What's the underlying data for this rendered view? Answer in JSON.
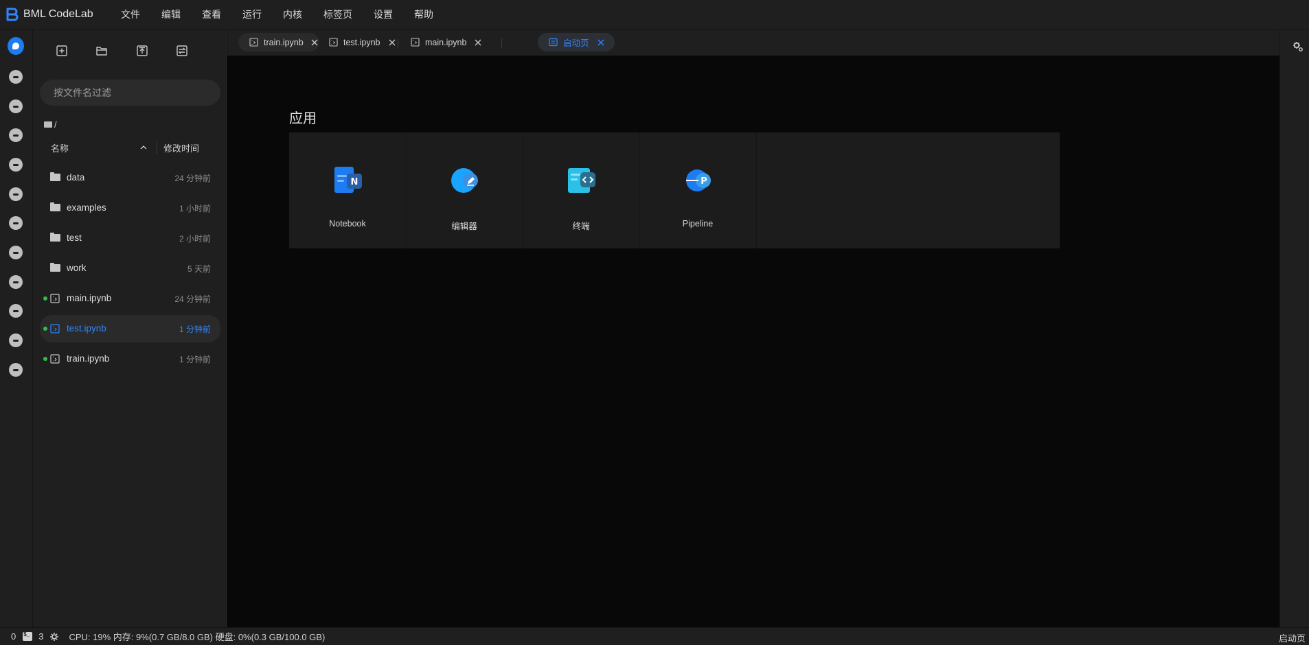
{
  "app": {
    "name": "BML CodeLab",
    "accent": "#1d7cf2"
  },
  "menu": [
    "文件",
    "编辑",
    "查看",
    "运行",
    "内核",
    "标签页",
    "设置",
    "帮助"
  ],
  "activity_bar": {
    "icons": [
      "file-browser-icon",
      "extensions-icon",
      "launch-icon",
      "dataset-icon",
      "terminal-icon",
      "toggle-icon",
      "deploy-icon",
      "run-icon",
      "notes-icon",
      "circle-icon",
      "chart-icon",
      "diamond-icon"
    ]
  },
  "file_browser": {
    "toolbar": [
      "new-file-icon",
      "new-folder-icon",
      "upload-icon",
      "refresh-icon"
    ],
    "search_placeholder": "按文件名过滤",
    "breadcrumb": "/",
    "header": {
      "name": "名称",
      "modified": "修改时间"
    },
    "items": [
      {
        "name": "data",
        "type": "folder",
        "modified": "24 分钟前",
        "running": false,
        "selected": false
      },
      {
        "name": "examples",
        "type": "folder",
        "modified": "1 小时前",
        "running": false,
        "selected": false
      },
      {
        "name": "test",
        "type": "folder",
        "modified": "2 小时前",
        "running": false,
        "selected": false
      },
      {
        "name": "work",
        "type": "folder",
        "modified": "5 天前",
        "running": false,
        "selected": false
      },
      {
        "name": "main.ipynb",
        "type": "notebook",
        "modified": "24 分钟前",
        "running": true,
        "selected": false
      },
      {
        "name": "test.ipynb",
        "type": "notebook",
        "modified": "1 分钟前",
        "running": true,
        "selected": true
      },
      {
        "name": "train.ipynb",
        "type": "notebook",
        "modified": "1 分钟前",
        "running": true,
        "selected": false
      }
    ]
  },
  "tabs": [
    {
      "label": "train.ipynb",
      "active": false
    },
    {
      "label": "test.ipynb",
      "active": false
    },
    {
      "label": "main.ipynb",
      "active": false
    },
    {
      "label": "启动页",
      "active": true
    }
  ],
  "launcher": {
    "section_title": "应用",
    "apps": [
      {
        "label": "Notebook",
        "icon": "notebook-icon"
      },
      {
        "label": "编辑器",
        "icon": "editor-icon"
      },
      {
        "label": "终端",
        "icon": "terminal-app-icon"
      },
      {
        "label": "Pipeline",
        "icon": "pipeline-icon"
      }
    ]
  },
  "status_bar": {
    "kernels": "0",
    "terminals": "3",
    "resources": "CPU:  19% 内存:  9%(0.7 GB/8.0 GB) 硬盘:  0%(0.3 GB/100.0 GB)",
    "right_label": "启动页"
  }
}
